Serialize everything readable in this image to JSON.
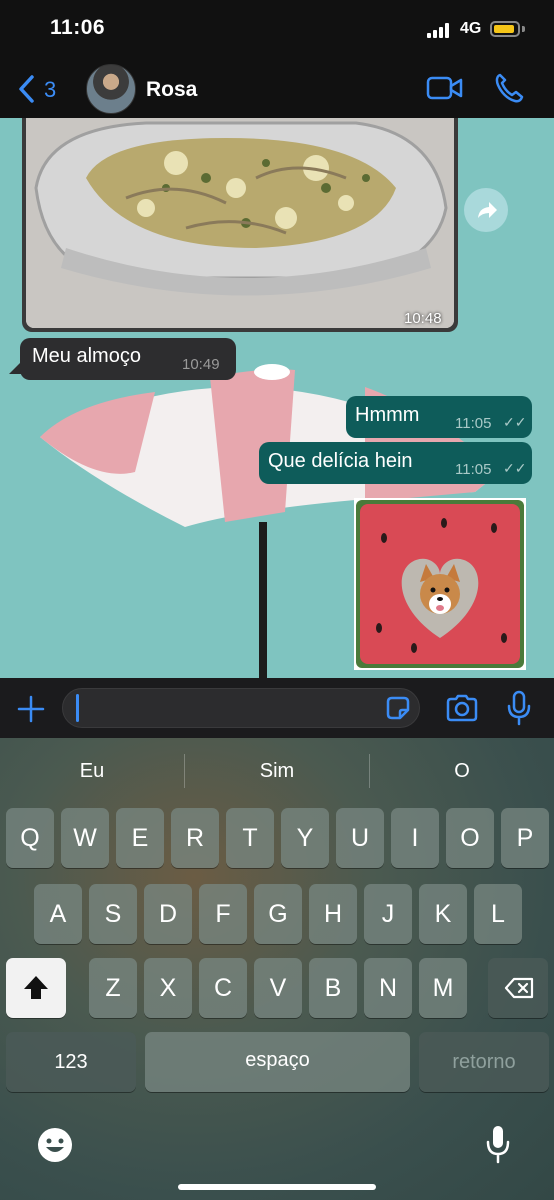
{
  "status": {
    "time": "11:06",
    "network": "4G"
  },
  "header": {
    "back_count": "3",
    "contact_name": "Rosa"
  },
  "messages": {
    "photo_time": "10:48",
    "incoming_text": "Meu almoço",
    "incoming_time": "10:49",
    "out1_text": "Hmmm",
    "out1_time": "11:05",
    "out2_text": "Que delícia hein",
    "out2_time": "11:05"
  },
  "input": {
    "placeholder": ""
  },
  "keyboard": {
    "suggestions": [
      "Eu",
      "Sim",
      "O"
    ],
    "row1": [
      "Q",
      "W",
      "E",
      "R",
      "T",
      "Y",
      "U",
      "I",
      "O",
      "P"
    ],
    "row2": [
      "A",
      "S",
      "D",
      "F",
      "G",
      "H",
      "J",
      "K",
      "L"
    ],
    "row3": [
      "Z",
      "X",
      "C",
      "V",
      "B",
      "N",
      "M"
    ],
    "numbers_label": "123",
    "space_label": "espaço",
    "return_label": "retorno"
  },
  "colors": {
    "accent": "#3b8cf5",
    "outgoing_bubble": "#0e5c5a",
    "incoming_bubble": "#2d2d2f",
    "chat_wallpaper": "#7fc4c0"
  }
}
